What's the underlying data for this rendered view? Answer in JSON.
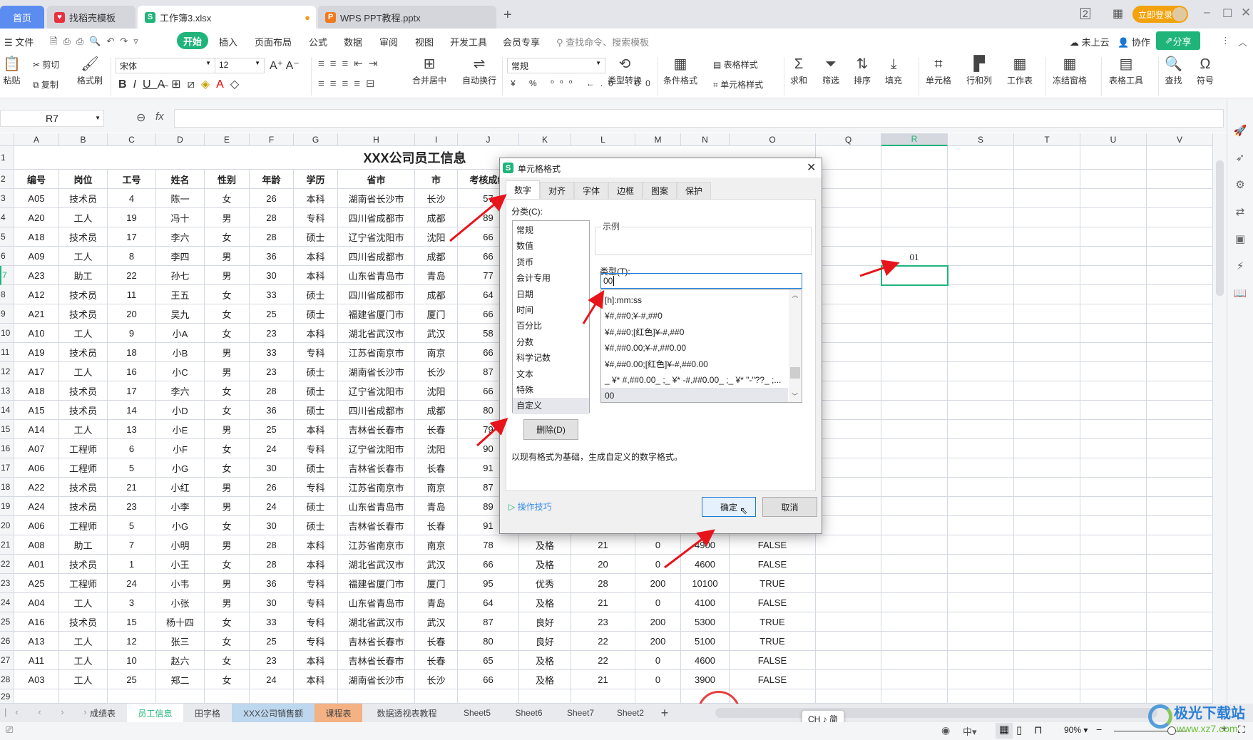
{
  "titlebar": {
    "tabs": [
      {
        "label": "首页",
        "icon": "home"
      },
      {
        "label": "找稻壳模板",
        "icon": "docer-icon"
      },
      {
        "label": "工作簿3.xlsx",
        "icon": "S",
        "active": true
      },
      {
        "label": "WPS PPT教程.pptx",
        "icon": "P"
      }
    ],
    "new_tab": "+",
    "login": "立即登录"
  },
  "menu": {
    "file": "文件",
    "items": [
      "开始",
      "插入",
      "页面布局",
      "公式",
      "数据",
      "审阅",
      "视图",
      "开发工具",
      "会员专享"
    ],
    "search_placeholder": "查找命令、搜索模板",
    "cloud": "未上云",
    "collab": "协作",
    "share": "分享"
  },
  "ribbon": {
    "paste": "粘贴",
    "cut": "剪切",
    "copy": "复制",
    "format_painter": "格式刷",
    "font_name": "宋体",
    "font_size": "12",
    "merge": "合并居中",
    "wrap": "自动换行",
    "number_format": "常规",
    "type_convert": "类型转换",
    "cond_format": "条件格式",
    "table_style": "表格样式",
    "cell_style": "单元格样式",
    "sum": "求和",
    "filter": "筛选",
    "sort": "排序",
    "fill": "填充",
    "cell": "单元格",
    "rowcol": "行和列",
    "sheet": "工作表",
    "freeze": "冻结窗格",
    "tools": "表格工具",
    "find": "查找",
    "symbol": "符号"
  },
  "formula_bar": {
    "cell_ref": "R7",
    "fx": "fx",
    "value": ""
  },
  "sheet": {
    "columns": [
      "A",
      "B",
      "C",
      "D",
      "E",
      "F",
      "G",
      "H",
      "I",
      "J",
      "K",
      "L",
      "M",
      "N",
      "O",
      "Q",
      "R",
      "S",
      "T",
      "U",
      "V"
    ],
    "selected_column": "R",
    "selected_cell": "R7",
    "title": "XXX公司员工信息",
    "headers": [
      "编号",
      "岗位",
      "工号",
      "姓名",
      "性别",
      "年龄",
      "学历",
      "省市",
      "市",
      "考核成绩"
    ],
    "r6_value": "01",
    "rows": [
      [
        "A05",
        "技术员",
        "4",
        "陈一",
        "女",
        "26",
        "本科",
        "湖南省长沙市",
        "长沙",
        "57"
      ],
      [
        "A20",
        "工人",
        "19",
        "冯十",
        "男",
        "28",
        "专科",
        "四川省成都市",
        "成都",
        "89"
      ],
      [
        "A18",
        "技术员",
        "17",
        "李六",
        "女",
        "28",
        "硕士",
        "辽宁省沈阳市",
        "沈阳",
        "66"
      ],
      [
        "A09",
        "工人",
        "8",
        "李四",
        "男",
        "36",
        "本科",
        "四川省成都市",
        "成都",
        "66"
      ],
      [
        "A23",
        "助工",
        "22",
        "孙七",
        "男",
        "30",
        "本科",
        "山东省青岛市",
        "青岛",
        "77"
      ],
      [
        "A12",
        "技术员",
        "11",
        "王五",
        "女",
        "33",
        "硕士",
        "四川省成都市",
        "成都",
        "64"
      ],
      [
        "A21",
        "技术员",
        "20",
        "吴九",
        "女",
        "25",
        "硕士",
        "福建省厦门市",
        "厦门",
        "66"
      ],
      [
        "A10",
        "工人",
        "9",
        "小A",
        "女",
        "23",
        "本科",
        "湖北省武汉市",
        "武汉",
        "58"
      ],
      [
        "A19",
        "技术员",
        "18",
        "小B",
        "男",
        "33",
        "专科",
        "江苏省南京市",
        "南京",
        "66"
      ],
      [
        "A17",
        "工人",
        "16",
        "小C",
        "男",
        "23",
        "硕士",
        "湖南省长沙市",
        "长沙",
        "87"
      ],
      [
        "A18",
        "技术员",
        "17",
        "李六",
        "女",
        "28",
        "硕士",
        "辽宁省沈阳市",
        "沈阳",
        "66"
      ],
      [
        "A15",
        "技术员",
        "14",
        "小D",
        "女",
        "36",
        "硕士",
        "四川省成都市",
        "成都",
        "80"
      ],
      [
        "A14",
        "工人",
        "13",
        "小E",
        "男",
        "25",
        "本科",
        "吉林省长春市",
        "长春",
        "79"
      ],
      [
        "A07",
        "工程师",
        "6",
        "小F",
        "女",
        "24",
        "专科",
        "辽宁省沈阳市",
        "沈阳",
        "90"
      ],
      [
        "A06",
        "工程师",
        "5",
        "小G",
        "女",
        "30",
        "硕士",
        "吉林省长春市",
        "长春",
        "91"
      ],
      [
        "A22",
        "技术员",
        "21",
        "小红",
        "男",
        "26",
        "专科",
        "江苏省南京市",
        "南京",
        "87"
      ],
      [
        "A24",
        "技术员",
        "23",
        "小李",
        "男",
        "24",
        "硕士",
        "山东省青岛市",
        "青岛",
        "89"
      ],
      [
        "A06",
        "工程师",
        "5",
        "小G",
        "女",
        "30",
        "硕士",
        "吉林省长春市",
        "长春",
        "91"
      ],
      [
        "A08",
        "助工",
        "7",
        "小明",
        "男",
        "28",
        "本科",
        "江苏省南京市",
        "南京",
        "78",
        "及格",
        "21",
        "0",
        "4900",
        "FALSE"
      ],
      [
        "A01",
        "技术员",
        "1",
        "小王",
        "女",
        "28",
        "本科",
        "湖北省武汉市",
        "武汉",
        "66",
        "及格",
        "20",
        "0",
        "4600",
        "FALSE"
      ],
      [
        "A25",
        "工程师",
        "24",
        "小韦",
        "男",
        "36",
        "专科",
        "福建省厦门市",
        "厦门",
        "95",
        "优秀",
        "28",
        "200",
        "10100",
        "TRUE"
      ],
      [
        "A04",
        "工人",
        "3",
        "小张",
        "男",
        "30",
        "专科",
        "山东省青岛市",
        "青岛",
        "64",
        "及格",
        "21",
        "0",
        "4100",
        "FALSE"
      ],
      [
        "A16",
        "技术员",
        "15",
        "杨十四",
        "女",
        "33",
        "专科",
        "湖北省武汉市",
        "武汉",
        "87",
        "良好",
        "23",
        "200",
        "5300",
        "TRUE"
      ],
      [
        "A13",
        "工人",
        "12",
        "张三",
        "女",
        "25",
        "专科",
        "吉林省长春市",
        "长春",
        "80",
        "良好",
        "22",
        "200",
        "5100",
        "TRUE"
      ],
      [
        "A11",
        "工人",
        "10",
        "赵六",
        "女",
        "23",
        "本科",
        "吉林省长春市",
        "长春",
        "65",
        "及格",
        "22",
        "0",
        "4600",
        "FALSE"
      ],
      [
        "A03",
        "工人",
        "25",
        "郑二",
        "女",
        "24",
        "本科",
        "湖南省长沙市",
        "长沙",
        "66",
        "及格",
        "21",
        "0",
        "3900",
        "FALSE"
      ]
    ]
  },
  "sheet_tabs": [
    {
      "label": "成绩表"
    },
    {
      "label": "员工信息",
      "active": true
    },
    {
      "label": "田字格"
    },
    {
      "label": "XXX公司销售额",
      "color": "#bdd7ee"
    },
    {
      "label": "课程表",
      "color": "#f4b183"
    },
    {
      "label": "数据透视表教程"
    },
    {
      "label": "Sheet5"
    },
    {
      "label": "Sheet6"
    },
    {
      "label": "Sheet7"
    },
    {
      "label": "Sheet2"
    }
  ],
  "ime": "CH ♪ 简",
  "statusbar": {
    "zoom": "90%",
    "zoom_level_percent": 90
  },
  "watermark": {
    "name": "极光下载站",
    "url": "www.xz7.com"
  },
  "dialog": {
    "title": "单元格格式",
    "tabs": [
      "数字",
      "对齐",
      "字体",
      "边框",
      "图案",
      "保护"
    ],
    "active_tab": "数字",
    "category_label": "分类(C):",
    "categories": [
      "常规",
      "数值",
      "货币",
      "会计专用",
      "日期",
      "时间",
      "百分比",
      "分数",
      "科学记数",
      "文本",
      "特殊",
      "自定义"
    ],
    "selected_category": "自定义",
    "sample_label": "示例",
    "type_label": "类型(T):",
    "type_value": "00",
    "formats": [
      "[h]:mm:ss",
      "¥#,##0;¥-#,##0",
      "¥#,##0;[红色]¥-#,##0",
      "¥#,##0.00;¥-#,##0.00",
      "¥#,##0.00;[红色]¥-#,##0.00",
      "_ ¥* #,##0.00_ ;_ ¥* -#,##0.00_ ;_ ¥* \"-\"??_ ;...",
      "00"
    ],
    "selected_format": "00",
    "delete_button": "删除(D)",
    "description": "以现有格式为基础，生成自定义的数字格式。",
    "tips": "操作技巧",
    "ok": "确定",
    "cancel": "取消"
  },
  "colors": {
    "accent": "#1fb47a",
    "annotation": "#e8141b",
    "selection": "#1fb47a"
  }
}
